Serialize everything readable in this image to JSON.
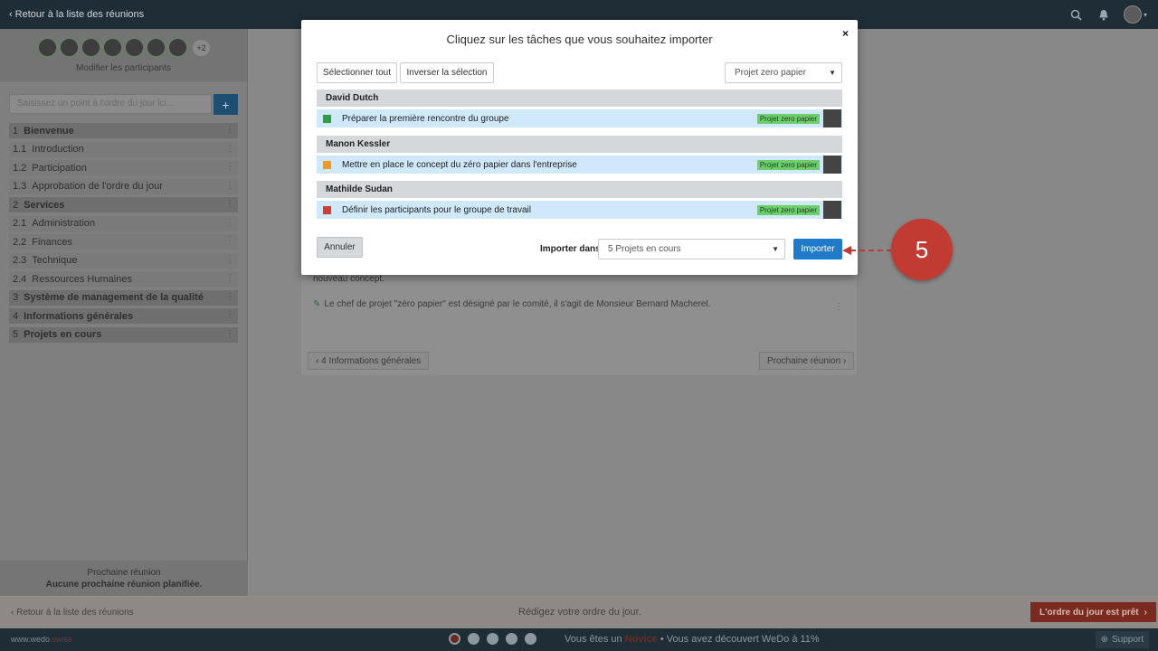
{
  "topbar": {
    "back_label": "Retour à la liste des réunions"
  },
  "sidebar": {
    "more_participants": "+2",
    "edit_participants": "Modifier les participants",
    "agenda_placeholder": "Saisissez un point à l'ordre du jour ici...",
    "add_label": "+",
    "items": [
      {
        "num": "1",
        "label": "Bienvenue",
        "section": true
      },
      {
        "num": "1.1",
        "label": "Introduction",
        "section": false
      },
      {
        "num": "1.2",
        "label": "Participation",
        "section": false
      },
      {
        "num": "1.3",
        "label": "Approbation de l'ordre du jour",
        "section": false
      },
      {
        "num": "2",
        "label": "Services",
        "section": true
      },
      {
        "num": "2.1",
        "label": "Administration",
        "section": false
      },
      {
        "num": "2.2",
        "label": "Finances",
        "section": false
      },
      {
        "num": "2.3",
        "label": "Technique",
        "section": false
      },
      {
        "num": "2.4",
        "label": "Ressources Humaines",
        "section": false
      },
      {
        "num": "3",
        "label": "Système de management de la qualité",
        "section": true
      },
      {
        "num": "4",
        "label": "Informations générales",
        "section": true
      },
      {
        "num": "5",
        "label": "Projets en cours",
        "section": true
      }
    ],
    "next_meeting_title": "Prochaine réunion",
    "next_meeting_value": "Aucune prochaine réunion planifiée."
  },
  "main": {
    "text_fragment": "nouveau concept.",
    "note": "Le chef de projet \"zéro papier\" est désigné par le comité, il s'agit de Monsieur Bernard Macherel.",
    "prev_label": "4 Informations générales",
    "next_label": "Prochaine réunion"
  },
  "modal": {
    "title": "Cliquez sur les tâches que vous souhaitez importer",
    "close": "×",
    "select_all": "Sélectionner tout",
    "invert": "Inverser la sélection",
    "project_filter": "Projet zero papier",
    "groups": [
      {
        "name": "David Dutch",
        "task": "Préparer la première rencontre du groupe",
        "tag": "Projet zero papier",
        "color": "#2e9e3e"
      },
      {
        "name": "Manon Kessler",
        "task": "Mettre en place le concept du zéro papier dans l'entreprise",
        "tag": "Projet zero papier",
        "color": "#f39a1e"
      },
      {
        "name": "Mathilde Sudan",
        "task": "Définir les participants pour le groupe de travail",
        "tag": "Projet zero papier",
        "color": "#d23a32"
      }
    ],
    "cancel": "Annuler",
    "import_into_label": "Importer dans:",
    "import_into_value": "5 Projets en cours",
    "import_button": "Importer"
  },
  "status_strip": {
    "back_label": "Retour à la liste des réunions",
    "center": "Rédigez votre ordre du jour.",
    "ready": "L'ordre du jour est prêt"
  },
  "footer": {
    "brand": "www.wedo",
    "brand_suffix": ".swiss",
    "msg_prefix": "Vous êtes un",
    "msg_level": "Novice",
    "msg_suffix": "• Vous avez découvert WeDo à 11%",
    "support": "Support"
  },
  "annotation": {
    "step": "5"
  }
}
